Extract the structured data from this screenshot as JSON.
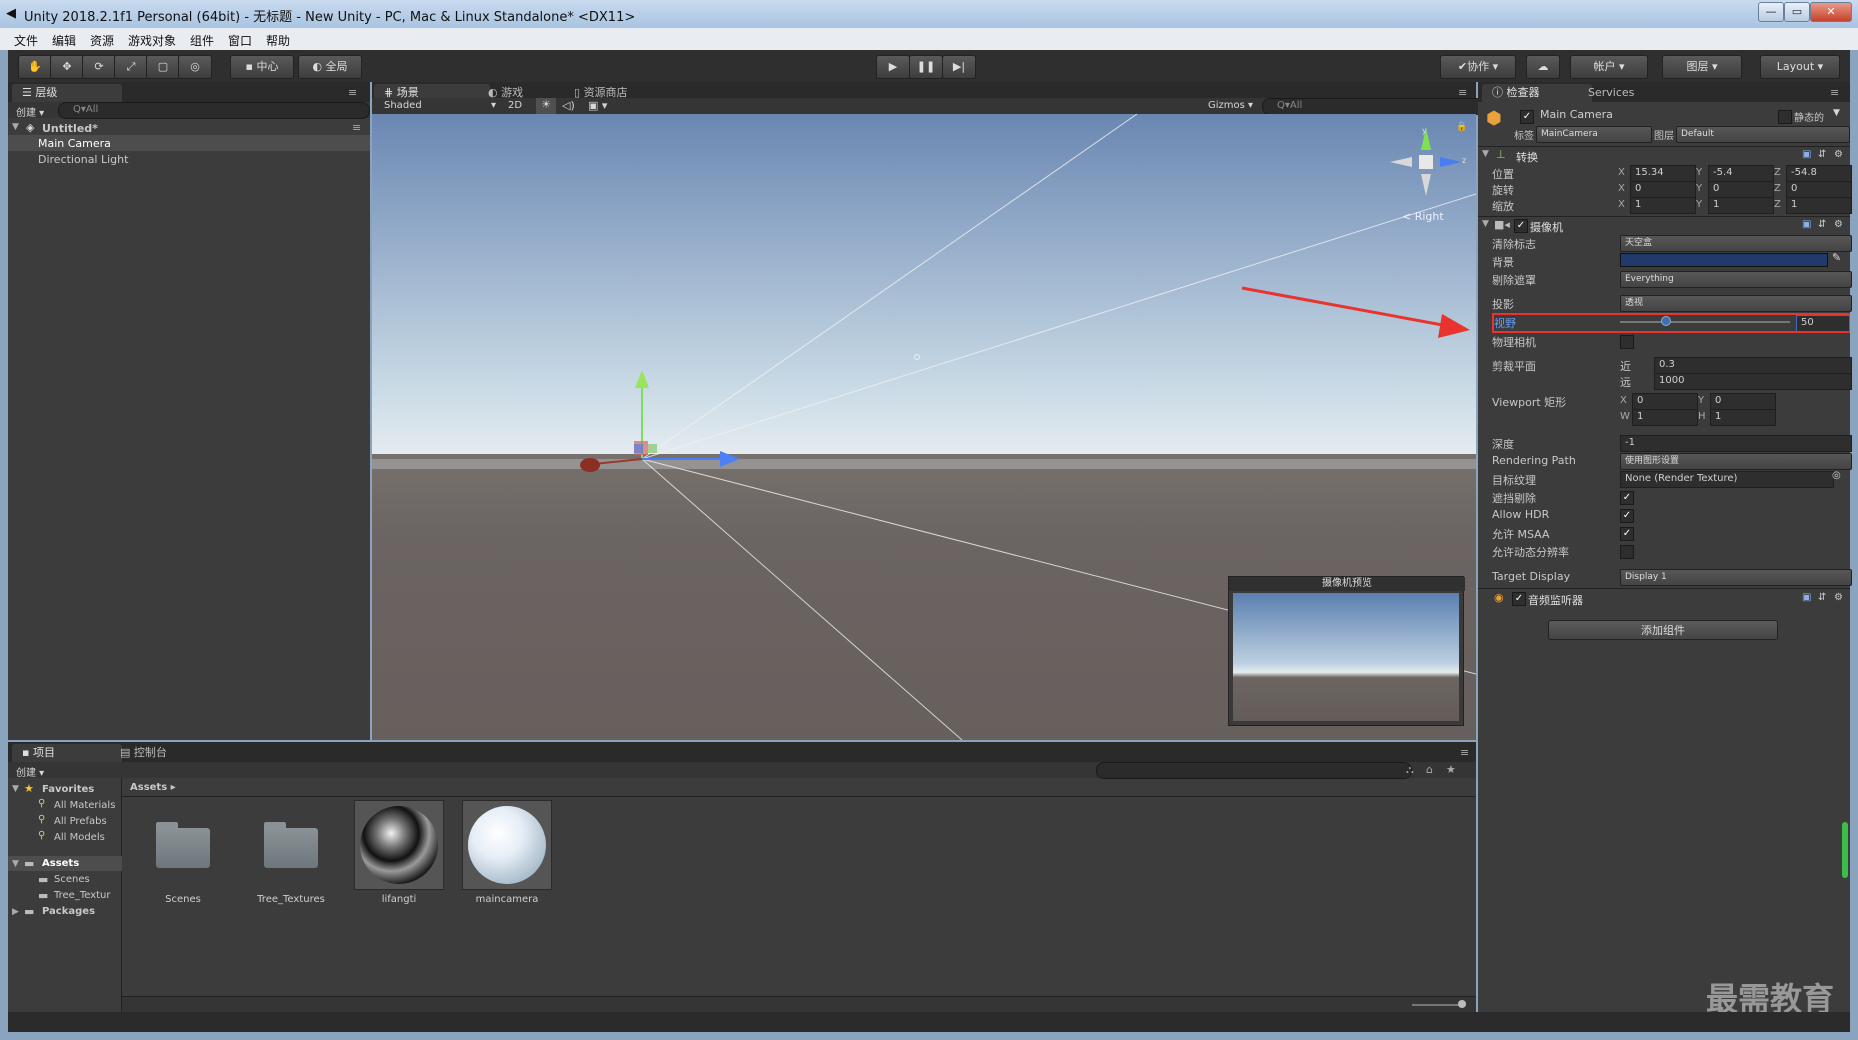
{
  "window": {
    "title": "Unity 2018.2.1f1 Personal (64bit) - 无标题 - New Unity - PC, Mac & Linux Standalone* <DX11>",
    "minimize": "—",
    "maximize": "▭",
    "close": "✕"
  },
  "menu": [
    "文件",
    "编辑",
    "资源",
    "游戏对象",
    "组件",
    "窗口",
    "帮助"
  ],
  "toolbar": {
    "pivot": "中心",
    "global": "全局",
    "collab": "协作",
    "account": "帐户",
    "layers": "图层",
    "layout": "Layout"
  },
  "hierarchy": {
    "tab": "层级",
    "create": "创建",
    "search_placeholder": "Q▾All",
    "scene": "Untitled*",
    "items": [
      "Main Camera",
      "Directional Light"
    ]
  },
  "scene_view": {
    "tabs": [
      "场景",
      "游戏",
      "资源商店"
    ],
    "shading": "Shaded",
    "mode2d": "2D",
    "gizmos": "Gizmos",
    "search_placeholder": "Q▾All",
    "gizmo_label": "Right",
    "gizmo_axes": [
      "y",
      "z"
    ],
    "preview_title": "摄像机预览"
  },
  "project": {
    "tabs": [
      "项目",
      "控制台"
    ],
    "create": "创建",
    "favorites_header": "Favorites",
    "favorites": [
      "All Materials",
      "All Prefabs",
      "All Models"
    ],
    "assets_header": "Assets",
    "assets_children": [
      "Scenes",
      "Tree_Textur"
    ],
    "packages": "Packages",
    "breadcrumb": "Assets",
    "assets": [
      {
        "name": "Scenes",
        "kind": "folder"
      },
      {
        "name": "Tree_Textures",
        "kind": "folder"
      },
      {
        "name": "lifangti",
        "kind": "material-dark"
      },
      {
        "name": "maincamera",
        "kind": "material-white"
      }
    ]
  },
  "inspector": {
    "tabs": [
      "检查器",
      "Services"
    ],
    "object_name": "Main Camera",
    "static_label": "静态的",
    "tag_label": "标签",
    "tag_value": "MainCamera",
    "layer_label": "图层",
    "layer_value": "Default",
    "transform": {
      "header": "转换",
      "position_label": "位置",
      "rotation_label": "旋转",
      "scale_label": "缩放",
      "position": [
        "15.34",
        "-5.4",
        "-54.8"
      ],
      "rotation": [
        "0",
        "0",
        "0"
      ],
      "scale": [
        "1",
        "1",
        "1"
      ],
      "axes": [
        "X",
        "Y",
        "Z"
      ]
    },
    "camera": {
      "header": "摄像机",
      "clear_flags_label": "清除标志",
      "clear_flags_value": "天空盒",
      "background_label": "背景",
      "culling_label": "剔除遮罩",
      "culling_value": "Everything",
      "projection_label": "投影",
      "projection_value": "透视",
      "fov_label": "视野",
      "fov_value": "50",
      "fov_fraction": 0.27,
      "physical_label": "物理相机",
      "clipping_label": "剪裁平面",
      "near_label": "近",
      "near_value": "0.3",
      "far_label": "远",
      "far_value": "1000",
      "viewport_label": "Viewport 矩形",
      "vp_x_label": "X",
      "vp_x": "0",
      "vp_y_label": "Y",
      "vp_y": "0",
      "vp_w_label": "W",
      "vp_w": "1",
      "vp_h_label": "H",
      "vp_h": "1",
      "depth_label": "深度",
      "depth_value": "-1",
      "render_path_label": "Rendering Path",
      "render_path_value": "使用图形设置",
      "target_texture_label": "目标纹理",
      "target_texture_value": "None (Render Texture)",
      "occlusion_label": "遮挡剔除",
      "hdr_label": "Allow HDR",
      "msaa_label": "允许 MSAA",
      "dynres_label": "允许动态分辨率",
      "target_display_label": "Target Display",
      "target_display_value": "Display 1"
    },
    "audio_listener": "音频监听器",
    "add_component": "添加组件"
  },
  "watermark": "最需教育",
  "colors": {
    "accent_red": "#e8332f",
    "selection_blue": "#3d6fb6",
    "camera_bg": "#1f3a6b"
  }
}
